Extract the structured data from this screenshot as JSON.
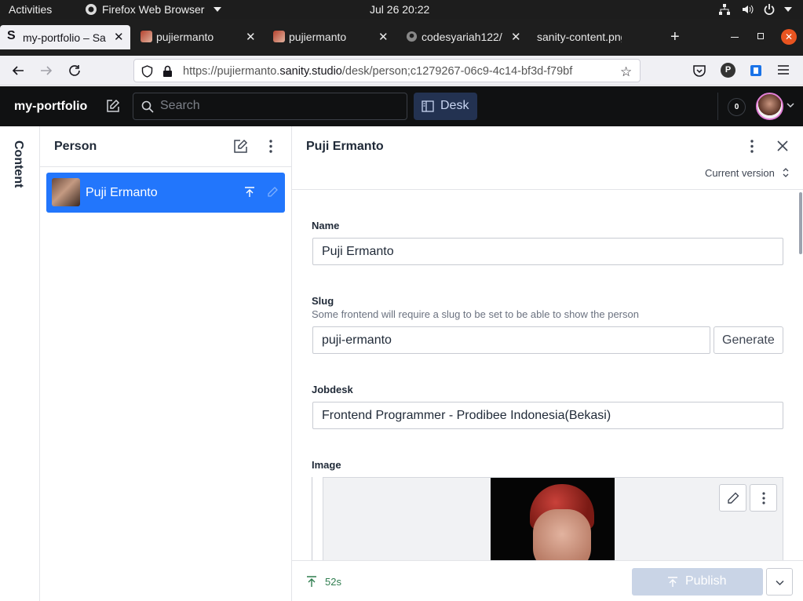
{
  "system": {
    "activities": "Activities",
    "app_menu": "Firefox Web Browser",
    "clock": "Jul 26  20:22"
  },
  "browser": {
    "tabs": [
      {
        "label": "my-portfolio – Sa",
        "active": true
      },
      {
        "label": "pujiermanto",
        "active": false
      },
      {
        "label": "pujiermanto",
        "active": false
      },
      {
        "label": "codesyariah122/",
        "active": false
      },
      {
        "label": "sanity-content.png (",
        "active": false
      }
    ],
    "new_tab": "+",
    "url_prefix": "https://pujiermanto.",
    "url_domain": "sanity.studio",
    "url_suffix": "/desk/person;c1279267-06c9-4c14-bf3d-f79bf",
    "profile_initial": "P"
  },
  "studio": {
    "project_title": "my-portfolio",
    "search_placeholder": "Search",
    "desk_label": "Desk",
    "notification_count": "0"
  },
  "rail": {
    "content_label": "Content"
  },
  "person_pane": {
    "title": "Person",
    "items": [
      {
        "name": "Puji Ermanto"
      }
    ]
  },
  "document": {
    "title": "Puji Ermanto",
    "version_label": "Current version",
    "fields": {
      "name": {
        "label": "Name",
        "value": "Puji Ermanto"
      },
      "slug": {
        "label": "Slug",
        "description": "Some frontend will require a slug to be set to be able to show the person",
        "value": "puji-ermanto",
        "generate_label": "Generate"
      },
      "jobdesk": {
        "label": "Jobdesk",
        "value": "Frontend Programmer  - Prodibee Indonesia(Bekasi)"
      },
      "image": {
        "label": "Image"
      }
    },
    "footer": {
      "last_published": "52s",
      "publish_label": "Publish"
    }
  },
  "colors": {
    "accent": "#2276fc",
    "header_bg": "#101112",
    "desk_bg": "#233251",
    "publish_disabled": "#c9d4e6"
  }
}
